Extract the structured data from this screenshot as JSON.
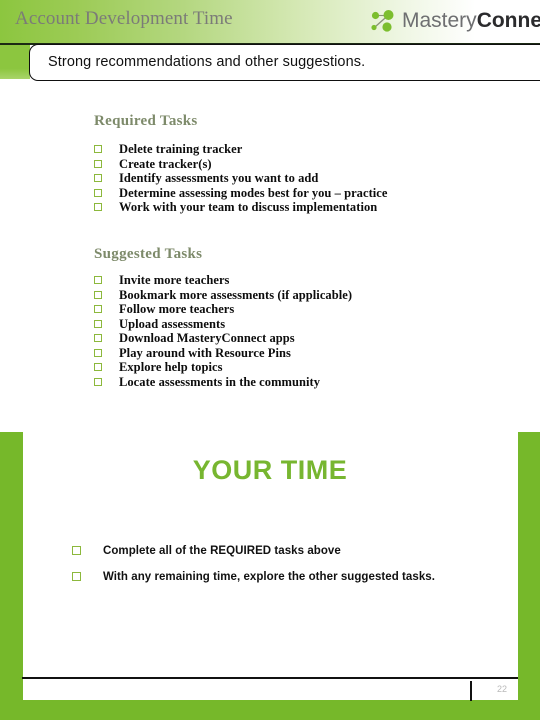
{
  "header": {
    "title": "Account Development Time",
    "logo": {
      "mark_name": "masteryconnect-dots-logo",
      "word_light": "Mastery",
      "word_bold": "Connect"
    },
    "accent_green": "#8cc63f"
  },
  "callout": {
    "text": "Strong recommendations and other suggestions."
  },
  "sections": [
    {
      "heading": "Required Tasks",
      "items": [
        "Delete training tracker",
        "Create tracker(s)",
        "Identify assessments you want to add",
        "Determine assessing modes best for you – practice",
        "Work with your team to discuss implementation"
      ]
    },
    {
      "heading": "Suggested Tasks",
      "items": [
        "Invite more teachers",
        "Bookmark more assessments (if applicable)",
        "Follow more teachers",
        "Upload assessments",
        "Download MasteryConnect apps",
        "Play around with Resource Pins",
        "Explore help topics",
        "Locate assessments in the community"
      ]
    }
  ],
  "your_time": {
    "heading": "YOUR TIME",
    "heading_color": "#77b630",
    "items": [
      "Complete all of the REQUIRED tasks above",
      "With any remaining time, explore the other suggested tasks."
    ]
  },
  "footer": {
    "page_number": "22"
  },
  "theme": {
    "band_green": "#76b82a",
    "checkbox_green": "#8cb83c",
    "title_gray": "#7b7b78",
    "section_heading_color": "#7d8a6a"
  }
}
